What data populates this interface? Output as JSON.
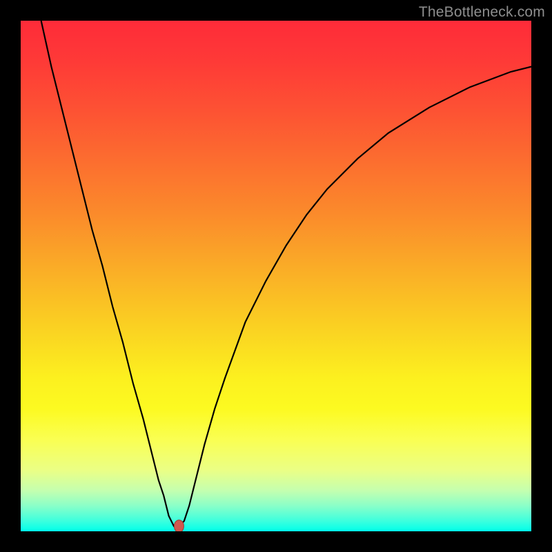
{
  "watermark": {
    "text": "TheBottleneck.com"
  },
  "colors": {
    "frame": "#000000",
    "curve": "#000000",
    "marker_fill": "#cf594e",
    "marker_stroke": "#9f3a32"
  },
  "chart_data": {
    "type": "line",
    "title": "",
    "xlabel": "",
    "ylabel": "",
    "xlim": [
      0,
      100
    ],
    "ylim": [
      0,
      100
    ],
    "grid": false,
    "legend": false,
    "series": [
      {
        "name": "curve",
        "x": [
          4,
          6,
          8,
          10,
          12,
          14,
          16,
          18,
          20,
          22,
          24,
          26,
          27,
          28,
          29,
          30,
          31,
          32,
          33,
          34,
          36,
          38,
          40,
          44,
          48,
          52,
          56,
          60,
          66,
          72,
          80,
          88,
          96,
          100
        ],
        "y": [
          100,
          91,
          83,
          75,
          67,
          59,
          52,
          44,
          37,
          29,
          22,
          14,
          10,
          7,
          3,
          1,
          1,
          2,
          5,
          9,
          17,
          24,
          30,
          41,
          49,
          56,
          62,
          67,
          73,
          78,
          83,
          87,
          90,
          91
        ]
      }
    ],
    "marker": {
      "x": 31,
      "y": 1
    }
  }
}
